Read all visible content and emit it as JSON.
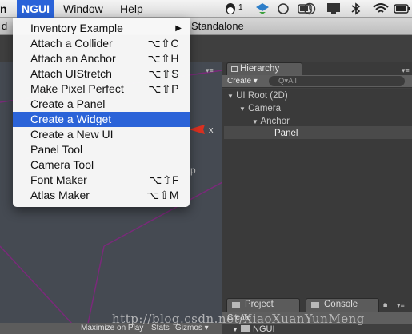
{
  "menubar": {
    "items": [
      {
        "label": "n"
      },
      {
        "label": "NGUI"
      },
      {
        "label": "Window"
      },
      {
        "label": "Help"
      }
    ],
    "notification_count": "1"
  },
  "toolbar": {
    "left_text": "d",
    "right_text": "Standalone"
  },
  "menu": {
    "items": [
      {
        "label": "Inventory Example",
        "shortcut": "",
        "submenu": true
      },
      {
        "label": "Attach a Collider",
        "shortcut": "⌥⇧C"
      },
      {
        "label": "Attach an Anchor",
        "shortcut": "⌥⇧H"
      },
      {
        "label": "Attach UIStretch",
        "shortcut": "⌥⇧S"
      },
      {
        "label": "Make Pixel Perfect",
        "shortcut": "⌥⇧P"
      },
      {
        "label": "Create a Panel",
        "shortcut": ""
      },
      {
        "label": "Create a Widget",
        "shortcut": "",
        "highlighted": true
      },
      {
        "label": "Create a New UI",
        "shortcut": ""
      },
      {
        "label": "Panel Tool",
        "shortcut": ""
      },
      {
        "label": "Camera Tool",
        "shortcut": ""
      },
      {
        "label": "Font Maker",
        "shortcut": "⌥⇧F"
      },
      {
        "label": "Atlas Maker",
        "shortcut": "⌥⇧M"
      }
    ]
  },
  "hierarchy": {
    "tab": "Hierarchy",
    "create": "Create ▾",
    "search_placeholder": "Q▾All",
    "tree": [
      {
        "label": "UI Root (2D)",
        "depth": 0,
        "expanded": true
      },
      {
        "label": "Camera",
        "depth": 1,
        "expanded": true
      },
      {
        "label": "Anchor",
        "depth": 2,
        "expanded": true
      },
      {
        "label": "Panel",
        "depth": 3,
        "selected": true
      }
    ]
  },
  "scene": {
    "gizmo_label": "x",
    "persp_label": "p"
  },
  "bottom": {
    "project_tab": "Project",
    "console_tab": "Console",
    "create": "Create",
    "folder": "NGUI",
    "game_toolbar": {
      "maximize": "Maximize on Play",
      "stats": "Stats",
      "gizmos": "Gizmos ▾"
    }
  },
  "watermark": "http://blog.csdn.net/XiaoXuanYunMeng",
  "colors": {
    "menu_highlight": "#2b63d8",
    "scene_grid_line": "#7a2a7a",
    "gizmo_arrow": "#d93020"
  }
}
